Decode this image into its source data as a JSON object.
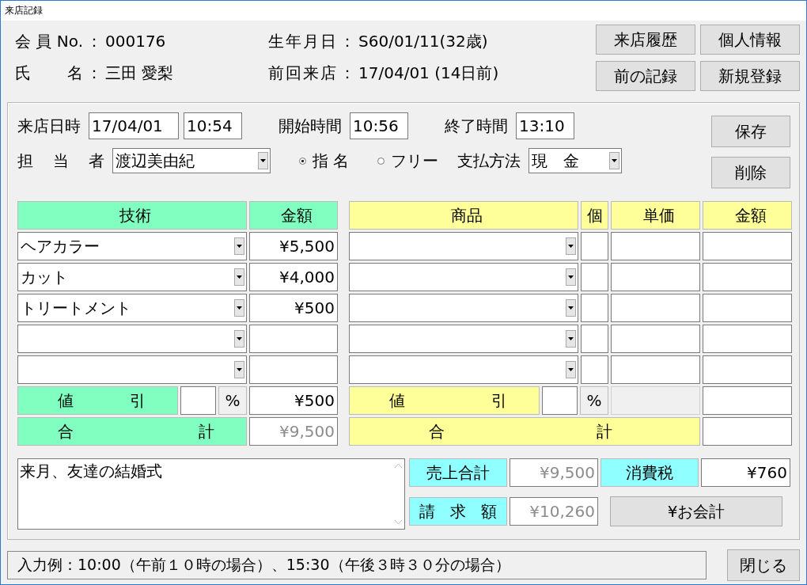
{
  "window": {
    "title": "来店記録"
  },
  "info": [
    {
      "label": "会員No.",
      "sep": "：",
      "value": "000176"
    },
    {
      "label": "生年月日",
      "sep": "：",
      "value": "S60/01/11(32歳)"
    },
    {
      "label": "氏 名",
      "sep": "：",
      "value": "三田 愛梨"
    },
    {
      "label": "前回来店",
      "sep": "：",
      "value": "17/04/01 (14日前)"
    }
  ],
  "header_buttons": [
    "来店履歴",
    "個人情報",
    "前の記録",
    "新規登録"
  ],
  "visit": {
    "label": "来店日時",
    "date": "17/04/01",
    "time": "10:54"
  },
  "start": {
    "label": "開始時間",
    "value": "10:56"
  },
  "end": {
    "label": "終了時間",
    "value": "13:10"
  },
  "staff": {
    "label": "担 当 者",
    "value": "渡辺美由紀"
  },
  "nomination": [
    {
      "label": "指 名",
      "selected": true
    },
    {
      "label": "フリー",
      "selected": false
    }
  ],
  "payment": {
    "label": "支払方法",
    "value": "現　金"
  },
  "side_buttons": [
    "保存",
    "削除"
  ],
  "services": {
    "columns": [
      "技術",
      "金額"
    ],
    "rows": [
      {
        "name": "ヘアカラー",
        "amount": "¥5,500"
      },
      {
        "name": "カット",
        "amount": "¥4,000"
      },
      {
        "name": "トリートメント",
        "amount": "¥500"
      },
      {},
      {}
    ],
    "discount": {
      "label": "値 引",
      "unit": "%",
      "amount": "¥500"
    },
    "total": {
      "label": "合 計",
      "amount": "¥9,500",
      "disabled": true
    }
  },
  "products": {
    "columns": [
      "商品",
      "個",
      "単価",
      "金額"
    ],
    "rows": [
      {
        "kind": "blank"
      },
      {
        "kind": "blank"
      },
      {
        "kind": "blank"
      },
      {
        "kind": "blank"
      },
      {
        "kind": "blank"
      }
    ],
    "discount": {
      "label": "値 引",
      "unit": "%"
    },
    "total": {
      "label": "合 計"
    }
  },
  "memo": "来月、友達の結婚式",
  "summary": {
    "sales": {
      "label": "売上合計",
      "value": "¥9,500",
      "disabled": true
    },
    "tax": {
      "label": "消費税",
      "value": "¥760",
      "disabled": false
    },
    "billed": {
      "label": "請 求 額",
      "value": "¥10,260",
      "disabled": true
    },
    "pay_button": "¥お会計"
  },
  "status": "入力例：10:00（午前１０時の場合）、15:30（午後３時３０分の場合）",
  "close_button": "閉じる"
}
